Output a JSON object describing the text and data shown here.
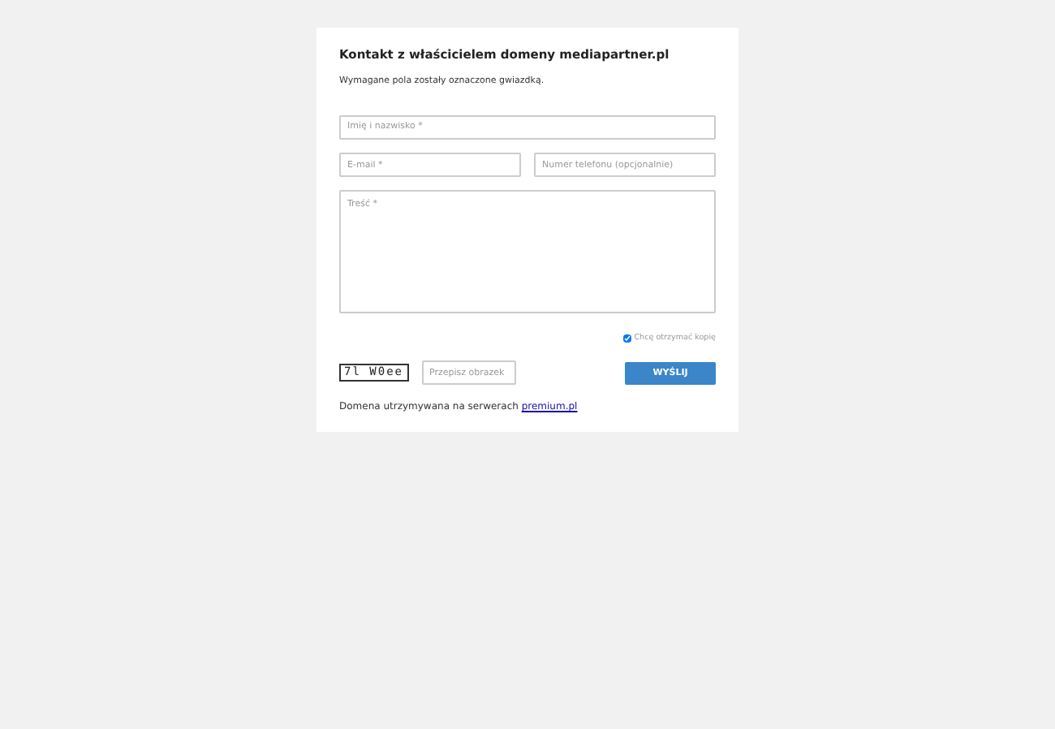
{
  "title": "Kontakt z właścicielem domeny mediapartner.pl",
  "note": "Wymagane pola zostały oznaczone gwiazdką.",
  "fields": [
    {
      "placeholder": "Imię i nazwisko *"
    },
    {
      "placeholder": "E-mail *"
    },
    {
      "placeholder": "Numer telefonu (opcjonalnie)"
    }
  ],
  "message": {
    "placeholder": "Treść *"
  },
  "copy": {
    "label": "Chcę otrzymać kopię",
    "checked": true
  },
  "captcha": {
    "text": "7l W0ee",
    "placeholder": "Przepisz obrazek"
  },
  "submit": "WYŚLIJ",
  "footer": {
    "text": "Domena utrzymywana na serwerach ",
    "link": "premium.pl"
  }
}
